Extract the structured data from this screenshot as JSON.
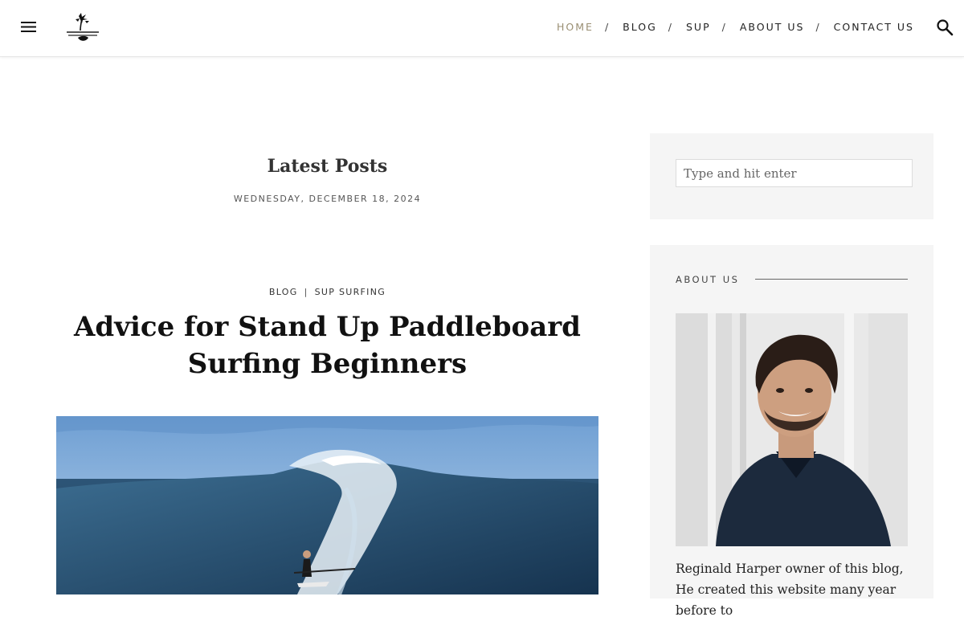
{
  "header": {
    "menu_icon": "hamburger-menu-icon",
    "logo_icon": "palm-tree-logo-icon",
    "search_icon": "search-icon",
    "nav": [
      {
        "label": "HOME",
        "active": true
      },
      {
        "label": "BLOG",
        "active": false
      },
      {
        "label": "SUP",
        "active": false
      },
      {
        "label": "ABOUT US",
        "active": false
      },
      {
        "label": "CONTACT US",
        "active": false
      }
    ],
    "nav_separator": "/",
    "active_color": "#9a8f73"
  },
  "main": {
    "section_title": "Latest Posts",
    "date": "WEDNESDAY, DECEMBER 18, 2024",
    "post": {
      "categories": [
        "BLOG",
        "SUP SURFING"
      ],
      "category_separator": "|",
      "title": "Advice for Stand Up Paddleboard Surfing Beginners"
    }
  },
  "sidebar": {
    "search": {
      "placeholder": "Type and hit enter",
      "value": ""
    },
    "about": {
      "title": "ABOUT US",
      "text": "Reginald Harper owner of this blog, He created this website many year before to"
    },
    "background": "#f5f5f5"
  }
}
